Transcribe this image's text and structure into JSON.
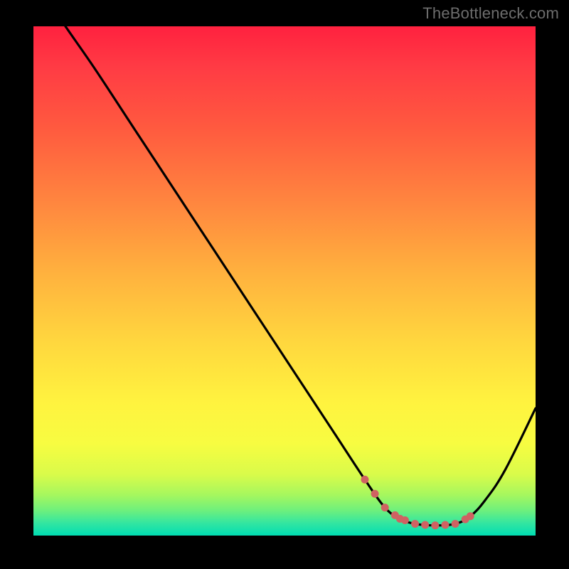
{
  "watermark": "TheBottleneck.com",
  "chart_data": {
    "type": "line",
    "title": "",
    "xlabel": "",
    "ylabel": "",
    "xlim": [
      0,
      100
    ],
    "ylim": [
      0,
      100
    ],
    "series": [
      {
        "name": "curve",
        "x": [
          0,
          5,
          12,
          20,
          28,
          36,
          44,
          52,
          60,
          66,
          70,
          73,
          76,
          80,
          84,
          87,
          90,
          94,
          100
        ],
        "y": [
          110,
          102,
          92,
          80,
          68,
          56,
          44,
          32,
          20,
          11,
          5.5,
          3.3,
          2.3,
          2.0,
          2.3,
          3.8,
          7,
          13,
          25
        ]
      },
      {
        "name": "highlight-dots",
        "x": [
          66,
          68,
          70,
          72,
          73,
          74,
          76,
          78,
          80,
          82,
          84,
          86,
          87
        ],
        "y": [
          11,
          8.2,
          5.5,
          4.0,
          3.3,
          3.0,
          2.3,
          2.1,
          2.0,
          2.1,
          2.3,
          3.2,
          3.8
        ]
      }
    ],
    "colors": {
      "curve_stroke": "#000000",
      "dot_fill": "#cf6262",
      "gradient_top": "#ff213f",
      "gradient_bottom": "#00ddb2"
    }
  }
}
